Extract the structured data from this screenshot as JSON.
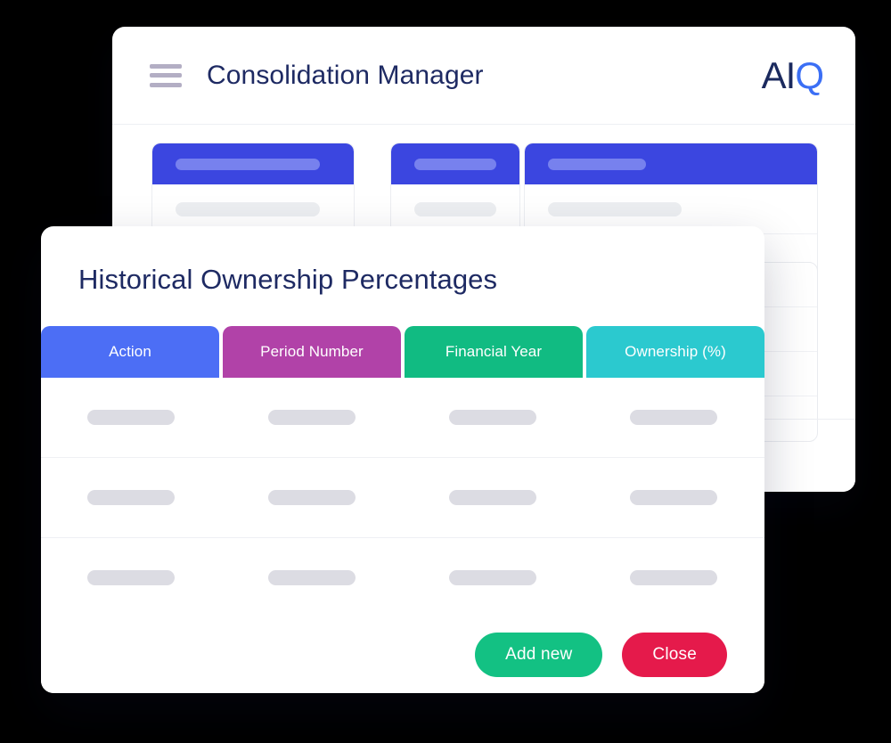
{
  "app_window": {
    "menu_icon": "hamburger-menu-icon",
    "title": "Consolidation Manager",
    "brand": {
      "part_a": "AI",
      "part_iq": "Q",
      "color_dark": "#1b2a5e",
      "color_blue": "#3b6ff5"
    },
    "skeleton_cards": [
      {
        "name": "card-one",
        "header_color": "#3b46e0",
        "rows": 4
      },
      {
        "name": "card-two",
        "header_color": "#3b46e0",
        "rows": 4
      },
      {
        "name": "card-three",
        "header_color": "#3b46e0",
        "rows": 4
      }
    ],
    "skeleton_panel": {
      "name": "side-panel",
      "rows": 4
    }
  },
  "modal": {
    "title": "Historical Ownership Percentages",
    "table": {
      "columns": [
        {
          "label": "Action",
          "color": "#4c6ef5"
        },
        {
          "label": "Period Number",
          "color": "#b142a8"
        },
        {
          "label": "Financial Year",
          "color": "#11bb82"
        },
        {
          "label": "Ownership (%)",
          "color": "#2bc9cf"
        }
      ],
      "rows": [
        {
          "cells": [
            "",
            "",
            "",
            ""
          ]
        },
        {
          "cells": [
            "",
            "",
            "",
            ""
          ]
        },
        {
          "cells": [
            "",
            "",
            "",
            ""
          ]
        }
      ],
      "placeholder_color": "#dcdce3"
    },
    "footer": {
      "add_label": "Add new",
      "add_color": "#13c183",
      "close_label": "Close",
      "close_color": "#e51a4b"
    }
  }
}
